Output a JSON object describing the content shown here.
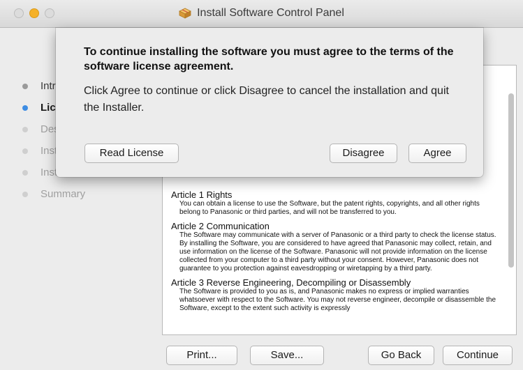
{
  "window": {
    "title": "Install Software Control Panel",
    "icon": "package-icon"
  },
  "steps": [
    {
      "label": "Introduction",
      "state": "done"
    },
    {
      "label": "License",
      "state": "current"
    },
    {
      "label": "Destination Select",
      "state": "pending"
    },
    {
      "label": "Installation Type",
      "state": "pending"
    },
    {
      "label": "Installation",
      "state": "pending"
    },
    {
      "label": "Summary",
      "state": "pending"
    }
  ],
  "license": {
    "articles": [
      {
        "title": "Article 1 Rights",
        "body": "You can obtain a license to use the Software, but the patent rights, copyrights, and all other rights belong to Panasonic or third parties, and will not be transferred to you."
      },
      {
        "title": "Article 2 Communication",
        "body": "The Software may communicate with a server of Panasonic or a third party to check the license status.",
        "body2": "By installing the Software, you are considered to have agreed that Panasonic may collect, retain, and use information on the license of the Software.  Panasonic will not provide information on the license collected from your computer to a third party without your consent.  However, Panasonic does not guarantee to you protection against eavesdropping or wiretapping by a third party."
      },
      {
        "title": "Article 3 Reverse Engineering, Decompiling or Disassembly",
        "body": "The Software is provided to you as is, and Panasonic makes no express or implied warranties whatsoever with respect to the Software. You may not reverse engineer, decompile or disassemble the Software, except to the extent such activity is expressly"
      }
    ]
  },
  "buttons": {
    "print": "Print...",
    "save": "Save...",
    "go_back": "Go Back",
    "continue": "Continue"
  },
  "sheet": {
    "heading": "To continue installing the software you must agree to the terms of the software license agreement.",
    "message": "Click Agree to continue or click Disagree to cancel the installation and quit the Installer.",
    "read_license": "Read License",
    "disagree": "Disagree",
    "agree": "Agree"
  },
  "colors": {
    "accent": "#3e8de3",
    "minimize": "#f5b128"
  }
}
